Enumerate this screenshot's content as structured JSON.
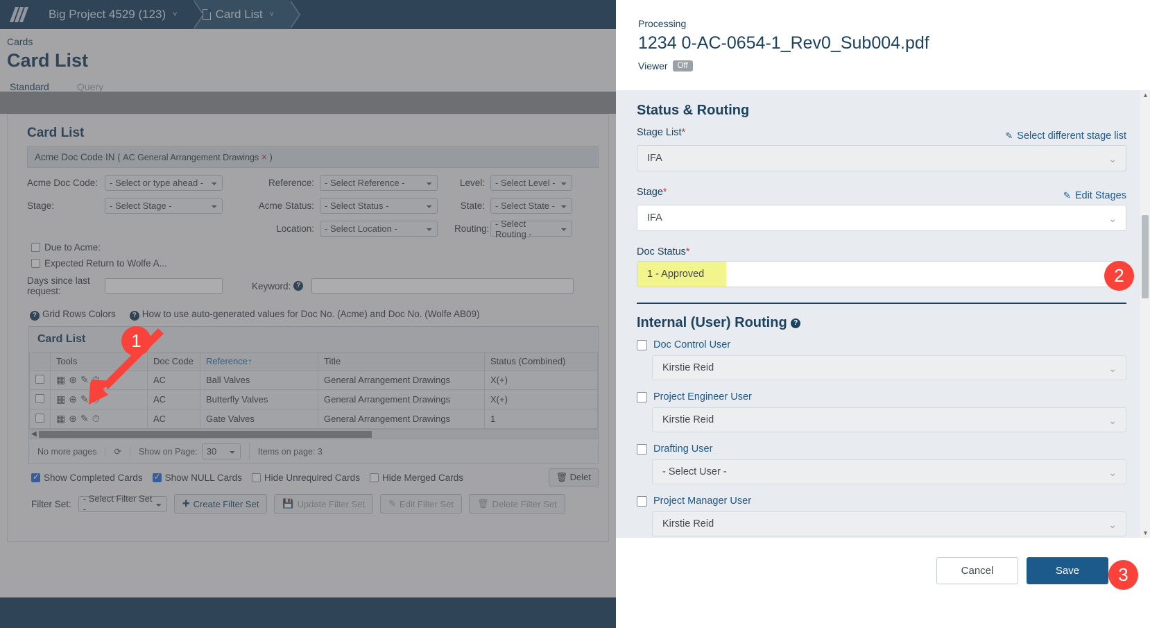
{
  "topnav": {
    "menu_icon": "hamburger-icon",
    "breadcrumbs": [
      {
        "label": "Big Project 4529 (123)",
        "caret": "˅"
      },
      {
        "label": "Card List",
        "caret": "˅",
        "icon": "document-icon"
      }
    ]
  },
  "page": {
    "breadcrumb": "Cards",
    "title": "Card List",
    "tabs": [
      {
        "label": "Standard",
        "active": true
      },
      {
        "label": "Query",
        "active": false
      }
    ]
  },
  "card_list": {
    "section_title": "Card List",
    "filter_chip": {
      "prefix": "Acme Doc Code IN",
      "open": "(",
      "value": "AC General Arrangement Drawings",
      "remove": "×",
      "close": ")"
    },
    "filters": [
      {
        "label": "Acme Doc Code:",
        "value": "- Select or type ahead -"
      },
      {
        "label": "Reference:",
        "value": "- Select Reference -"
      },
      {
        "label": "Level:",
        "value": "- Select Level -"
      },
      {
        "label": "Stage:",
        "value": "- Select Stage -"
      },
      {
        "label": "Acme Status:",
        "value": "- Select Status -"
      },
      {
        "label": "State:",
        "value": "- Select State -"
      },
      {
        "label": "Location:",
        "value": "- Select Location -"
      },
      {
        "label": "Routing:",
        "value": "- Select Routing -"
      }
    ],
    "checkboxes": [
      {
        "label": "Due to Acme:",
        "checked": false
      },
      {
        "label": "Expected Return to Wolfe A...",
        "checked": false
      }
    ],
    "days_label": "Days since last request:",
    "days_value": "",
    "keyword_label": "Keyword:",
    "keyword_value": "",
    "help_links": [
      "Grid Rows Colors",
      "How to use auto-generated values for Doc No. (Acme) and Doc No. (Wolfe AB09)"
    ],
    "grid": {
      "title": "Card List",
      "columns": [
        "",
        "Tools",
        "Doc Code",
        "Reference↑",
        "Title",
        "Status (Combined)"
      ],
      "rows": [
        {
          "tools": "◧ ⊕ ✎ ◴",
          "doc_code": "AC",
          "reference": "Ball Valves",
          "title": "General Arrangement Drawings",
          "status": "X(+)"
        },
        {
          "tools": "◧ ⊕ ✎ ◴",
          "doc_code": "AC",
          "reference": "Butterfly Valves",
          "title": "General Arrangement Drawings",
          "status": "X(+)"
        },
        {
          "tools": "◧ ⊕ ✎ ◴",
          "doc_code": "AC",
          "reference": "Gate Valves",
          "title": "General Arrangement Drawings",
          "status": "1"
        }
      ],
      "pager": {
        "no_more_pages": "No more pages",
        "refresh_icon": "refresh-icon",
        "show_on_page_label": "Show on Page:",
        "show_on_page_value": "30",
        "items_on_page": "Items on page: 3"
      }
    },
    "bottom_checkboxes": [
      {
        "label": "Show Completed Cards",
        "checked": true
      },
      {
        "label": "Show NULL Cards",
        "checked": true
      },
      {
        "label": "Hide Unrequired Cards",
        "checked": false
      },
      {
        "label": "Hide Merged Cards",
        "checked": false
      }
    ],
    "delete_button": "Delet",
    "filter_set": {
      "label": "Filter Set:",
      "selected": "- Select Filter Set -",
      "buttons": [
        {
          "label": "Create Filter Set",
          "icon": "plus-icon",
          "disabled": false
        },
        {
          "label": "Update Filter Set",
          "icon": "save-icon",
          "disabled": true
        },
        {
          "label": "Edit Filter Set",
          "icon": "pencil-icon",
          "disabled": true
        },
        {
          "label": "Delete Filter Set",
          "icon": "trash-icon",
          "disabled": true
        }
      ]
    }
  },
  "panel": {
    "eyebrow": "Processing",
    "filename": "1234 0-AC-0654-1_Rev0_Sub004.pdf",
    "viewer_label": "Viewer",
    "viewer_state": "Off",
    "status_routing": {
      "heading": "Status & Routing",
      "stage_list": {
        "label": "Stage List",
        "required": "*",
        "action": "Select different stage list",
        "action_icon": "pencil-icon",
        "value": "IFA"
      },
      "stage": {
        "label": "Stage",
        "required": "*",
        "action": "Edit Stages",
        "action_icon": "pencil-icon",
        "value": "IFA"
      },
      "doc_status": {
        "label": "Doc Status",
        "required": "*",
        "value": "1 - Approved",
        "highlight_color": "#f2f58c"
      }
    },
    "internal_routing": {
      "heading": "Internal (User) Routing",
      "help_icon": "help-icon",
      "rows": [
        {
          "label": "Doc Control User",
          "checked": false,
          "value": "Kirstie Reid"
        },
        {
          "label": "Project Engineer User",
          "checked": false,
          "value": "Kirstie Reid"
        },
        {
          "label": "Drafting User",
          "checked": false,
          "value": "- Select User -"
        },
        {
          "label": "Project Manager User",
          "checked": false,
          "value": "Kirstie Reid"
        }
      ]
    },
    "footer": {
      "cancel": "Cancel",
      "save": "Save"
    }
  },
  "markers": [
    {
      "number": "1",
      "color": "#f9423a"
    },
    {
      "number": "2",
      "color": "#f9423a"
    },
    {
      "number": "3",
      "color": "#f9423a"
    }
  ],
  "colors": {
    "nav_dark": "#1c4260",
    "accent_blue": "#1c5a8c",
    "marker_red": "#f9423a",
    "highlight_yellow": "#f2f58c"
  }
}
